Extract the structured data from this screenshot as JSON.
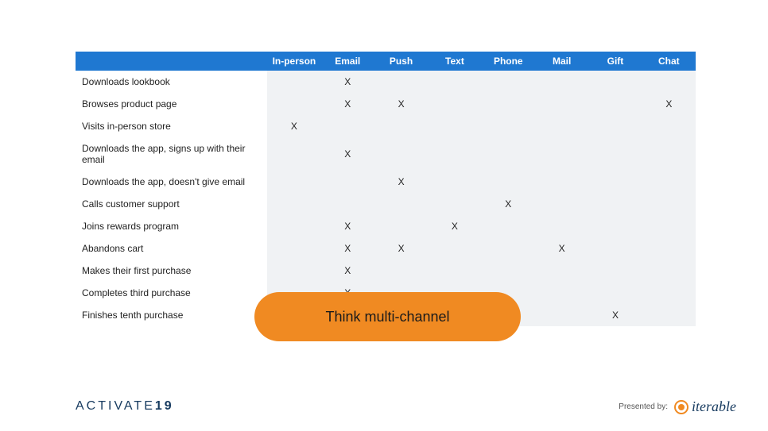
{
  "table": {
    "channels": [
      "In-person",
      "Email",
      "Push",
      "Text",
      "Phone",
      "Mail",
      "Gift",
      "Chat"
    ],
    "rows": [
      {
        "label": "Downloads lookbook",
        "marks": [
          "",
          "X",
          "",
          "",
          "",
          "",
          "",
          ""
        ]
      },
      {
        "label": "Browses product page",
        "marks": [
          "",
          "X",
          "X",
          "",
          "",
          "",
          "",
          "X"
        ]
      },
      {
        "label": "Visits in-person store",
        "marks": [
          "X",
          "",
          "",
          "",
          "",
          "",
          "",
          ""
        ]
      },
      {
        "label": "Downloads the app, signs up with their email",
        "marks": [
          "",
          "X",
          "",
          "",
          "",
          "",
          "",
          ""
        ]
      },
      {
        "label": "Downloads the app, doesn't give email",
        "marks": [
          "",
          "",
          "X",
          "",
          "",
          "",
          "",
          ""
        ]
      },
      {
        "label": "Calls customer support",
        "marks": [
          "",
          "",
          "",
          "",
          "X",
          "",
          "",
          ""
        ]
      },
      {
        "label": "Joins rewards program",
        "marks": [
          "",
          "X",
          "",
          "X",
          "",
          "",
          "",
          ""
        ]
      },
      {
        "label": "Abandons cart",
        "marks": [
          "",
          "X",
          "X",
          "",
          "",
          "X",
          "",
          ""
        ]
      },
      {
        "label": "Makes their first purchase",
        "marks": [
          "",
          "X",
          "",
          "",
          "",
          "",
          "",
          ""
        ]
      },
      {
        "label": "Completes third purchase",
        "marks": [
          "",
          "X",
          "",
          "",
          "",
          "",
          "",
          ""
        ]
      },
      {
        "label": "Finishes tenth purchase",
        "marks": [
          "",
          "",
          "",
          "",
          "",
          "",
          "X",
          ""
        ]
      }
    ]
  },
  "callout": "Think multi-channel",
  "footer": {
    "event_prefix": "ACTIVATE",
    "event_year": "19",
    "presented_by_label": "Presented by:",
    "brand": "iterable"
  }
}
